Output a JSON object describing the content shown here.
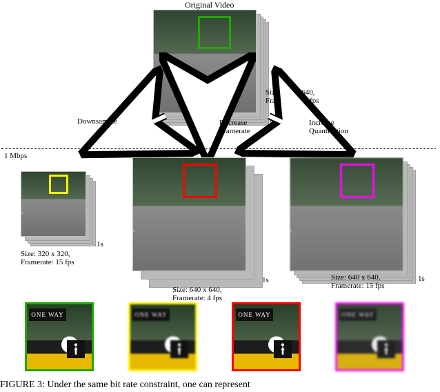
{
  "titles": {
    "original": "Original Video",
    "downsample": "Downsample",
    "decrease_fr": "Decrease\nFramerate",
    "increase_q": "Increase\nQuantization"
  },
  "bitrate_line": "1 Mbps",
  "frames": {
    "original": {
      "size": "Size: 640 x 640,",
      "fr": "Framerate: 15 fps"
    },
    "down": {
      "size": "Size: 320 x 320,",
      "fr": "Framerate: 15 fps"
    },
    "decfr": {
      "size": "Size: 640 x 640,",
      "fr": "Framerate: 4 fps"
    },
    "incq": {
      "size": "Size: 640 x 640,",
      "fr": "Framerate: 15 fps"
    }
  },
  "time_axis": "1s",
  "colors": {
    "green": "#21a800",
    "yellow": "#fff200",
    "red": "#ff0000",
    "magenta": "#ff00ff"
  },
  "sign_text": "ONE WAY",
  "caption": "FIGURE 3: Under the same bit rate constraint, one can represent"
}
